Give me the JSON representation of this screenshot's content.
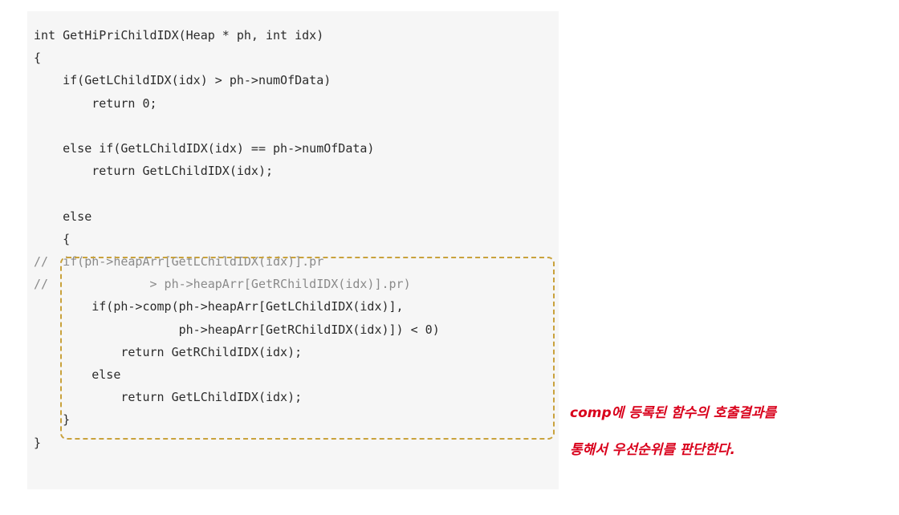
{
  "code": {
    "lines": [
      {
        "text": "int GetHiPriChildIDX(Heap * ph, int idx)",
        "kind": "code"
      },
      {
        "text": "{",
        "kind": "code"
      },
      {
        "text": "    if(GetLChildIDX(idx) > ph->numOfData)",
        "kind": "code"
      },
      {
        "text": "        return 0;",
        "kind": "code"
      },
      {
        "text": "",
        "kind": "code"
      },
      {
        "text": "    else if(GetLChildIDX(idx) == ph->numOfData)",
        "kind": "code"
      },
      {
        "text": "        return GetLChildIDX(idx);",
        "kind": "code"
      },
      {
        "text": "",
        "kind": "code"
      },
      {
        "text": "    else",
        "kind": "code"
      },
      {
        "text": "    {",
        "kind": "code"
      },
      {
        "text": "//  if(ph->heapArr[GetLChildIDX(idx)].pr",
        "kind": "comment"
      },
      {
        "text": "//              > ph->heapArr[GetRChildIDX(idx)].pr)",
        "kind": "comment"
      },
      {
        "text": "        if(ph->comp(ph->heapArr[GetLChildIDX(idx)],",
        "kind": "code"
      },
      {
        "text": "                    ph->heapArr[GetRChildIDX(idx)]) < 0)",
        "kind": "code"
      },
      {
        "text": "            return GetRChildIDX(idx);",
        "kind": "code"
      },
      {
        "text": "        else",
        "kind": "code"
      },
      {
        "text": "            return GetLChildIDX(idx);",
        "kind": "code"
      },
      {
        "text": "    }",
        "kind": "code"
      },
      {
        "text": "}",
        "kind": "code"
      }
    ]
  },
  "annotation": {
    "line1": "comp에 등록된 함수의 호출결과를",
    "line2": "통해서 우선순위를 판단한다."
  },
  "colors": {
    "code_text": "#2b2b2b",
    "comment_text": "#8a8a8a",
    "panel_bg": "#f6f6f6",
    "highlight_border": "#c9a23c",
    "annotation_text": "#d9001b"
  }
}
